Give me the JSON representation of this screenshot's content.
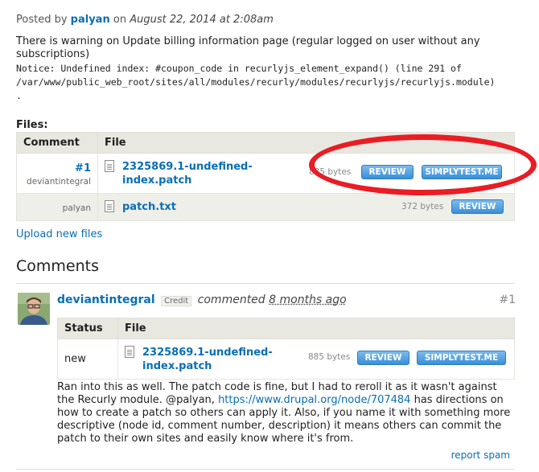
{
  "issue": {
    "posted_by_label": "Posted by",
    "author": "palyan",
    "on_label": "on",
    "date": "August 22, 2014 at 2:08am",
    "text": "There is warning on Update billing information page (regular logged on user without any subscriptions)",
    "notice": "Notice: Undefined index: #coupon_code in recurlyjs_element_expand() (line 291 of /var/www/public_web_root/sites/all/modules/recurly/modules/recurlyjs/recurlyjs.module)",
    "notice_end": "."
  },
  "files": {
    "label": "Files:",
    "headers": {
      "comment": "Comment",
      "file": "File"
    },
    "rows": [
      {
        "num": "#1",
        "user": "deviantintegral",
        "file_line1": "2325869.1-undefined-",
        "file_line2": "index.patch",
        "size": "885 bytes",
        "review": "REVIEW",
        "simplytest": "SIMPLYTEST.ME"
      },
      {
        "num": "",
        "user": "palyan",
        "file_line1": "patch.txt",
        "file_line2": "",
        "size": "372 bytes",
        "review": "REVIEW"
      }
    ],
    "upload": "Upload new files"
  },
  "comments": {
    "heading": "Comments",
    "items": [
      {
        "author": "deviantintegral",
        "credit": "Credit",
        "verb": "commented",
        "when": "8 months ago",
        "num": "#1",
        "table": {
          "headers": {
            "status": "Status",
            "file": "File"
          },
          "status": "new",
          "file_line1": "2325869.1-undefined-",
          "file_line2": "index.patch",
          "size": "885 bytes",
          "review": "REVIEW",
          "simplytest": "SIMPLYTEST.ME"
        },
        "body_before": "Ran into this as well. The patch code is fine, but I had to reroll it as it wasn't against the Recurly module. @palyan, ",
        "link": "https://www.drupal.org/node/707484",
        "body_after": " has directions on how to create a patch so others can apply it. Also, if you name it with something more descriptive (node id, comment number, description) it means others can commit the patch to their own sites and easily know where it's from.",
        "report": "report spam"
      }
    ]
  },
  "colors": {
    "link": "#0a6eb4",
    "button": "#3a8fd8",
    "annotation_circle": "#ea1c24"
  }
}
